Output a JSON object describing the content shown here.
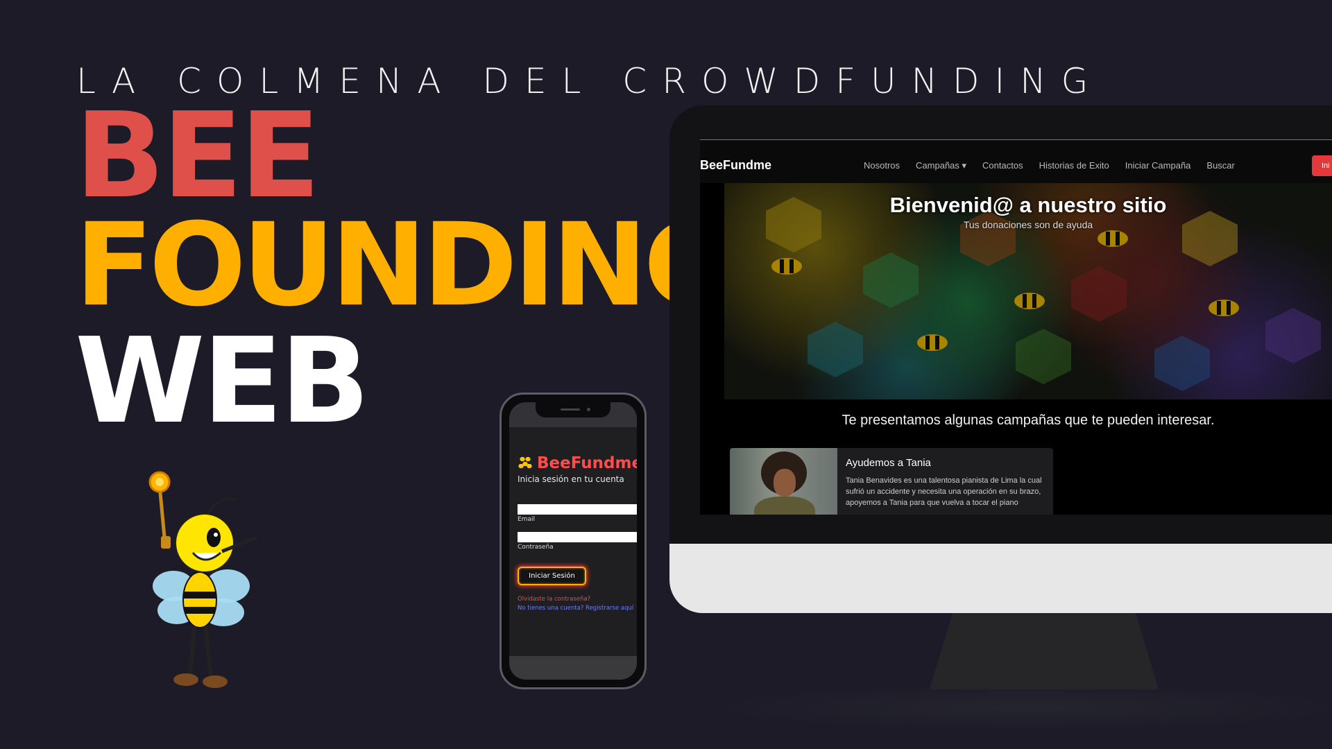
{
  "hero": {
    "tagline": "LA COLMENA DEL CROWDFUNDING",
    "title_line1": "BEE",
    "title_line2": "FOUNDING",
    "title_line3": "WEB"
  },
  "colors": {
    "background": "#1c1b27",
    "accent_red": "#e0504a",
    "accent_yellow": "#ffaf00",
    "white": "#ffffff"
  },
  "mobile_login": {
    "brand": "BeeFundme",
    "brand_icon": "honeycomb-bee-icon",
    "subtitle": "Inicia sesión en tu cuenta",
    "email_label": "Email",
    "email_value": "",
    "password_label": "Contraseña",
    "password_value": "",
    "login_button": "Iniciar Sesión",
    "forgot_password": "Olvidaste la contraseña?",
    "register": "No tienes una cuenta? Registrarse aquí"
  },
  "desktop_site": {
    "logo": "BeeFundme",
    "nav": [
      "Nosotros",
      "Campañas ▾",
      "Contactos",
      "Historias de Exito",
      "Iniciar Campaña",
      "Buscar"
    ],
    "login_button": "Ini",
    "hero_title": "Bienvenid@ a nuestro sitio",
    "hero_subtitle": "Tus donaciones son de ayuda",
    "section_title": "Te presentamos algunas campañas que te pueden interesar.",
    "campaign": {
      "title": "Ayudemos a Tania",
      "description": "Tania Benavides es una talentosa pianista de Lima la cual sufrió un accidente y necesita una operación en su brazo, apoyemos a Tania para que vuelva a tocar el piano"
    }
  }
}
